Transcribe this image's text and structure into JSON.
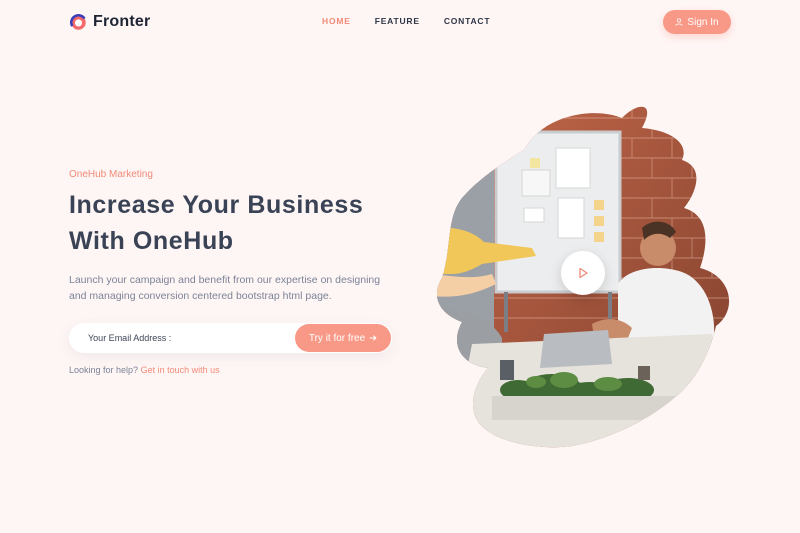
{
  "brand": {
    "name": "Fronter",
    "logo_icon": "ring-logo-icon"
  },
  "nav": {
    "items": [
      {
        "label": "HOME",
        "active": true
      },
      {
        "label": "FEATURE",
        "active": false
      },
      {
        "label": "CONTACT",
        "active": false
      }
    ]
  },
  "header": {
    "signin_label": "Sign In",
    "signin_icon": "user-icon"
  },
  "hero": {
    "eyebrow": "OneHub Marketing",
    "title_line1": "Increase Your Business",
    "title_line2": "With OneHub",
    "description": "Launch your campaign and benefit from our expertise on designing and managing conversion centered bootstrap html page.",
    "email_placeholder": "Your Email Address :",
    "cta_label": "Try it for free",
    "cta_icon": "arrow-right-icon",
    "help_text": "Looking for help?",
    "help_link": "Get in touch with us",
    "play_icon": "play-icon"
  },
  "colors": {
    "accent": "#f89987",
    "accent_text": "#f18a78",
    "background": "#fef6f5",
    "heading": "#3a4356"
  }
}
